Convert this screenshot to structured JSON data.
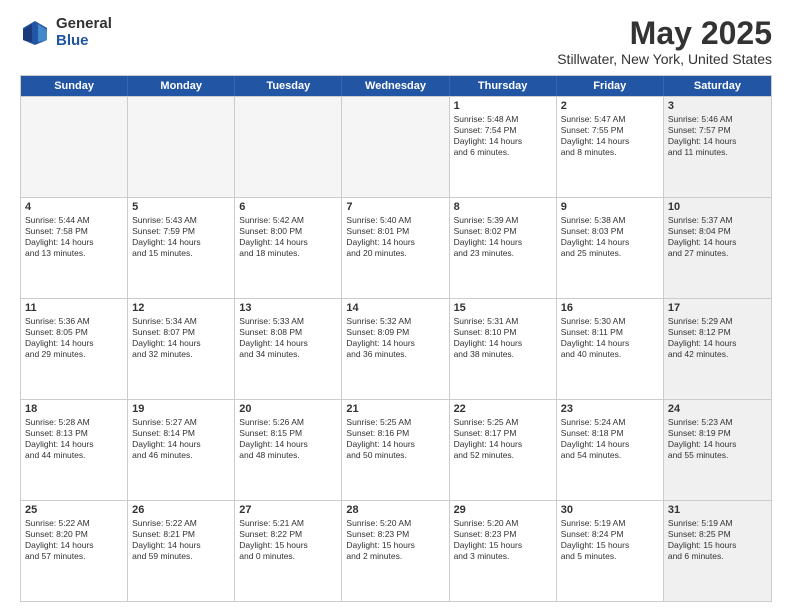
{
  "header": {
    "logo_general": "General",
    "logo_blue": "Blue",
    "title": "May 2025",
    "subtitle": "Stillwater, New York, United States"
  },
  "weekdays": [
    "Sunday",
    "Monday",
    "Tuesday",
    "Wednesday",
    "Thursday",
    "Friday",
    "Saturday"
  ],
  "rows": [
    [
      {
        "day": "",
        "info": "",
        "empty": true
      },
      {
        "day": "",
        "info": "",
        "empty": true
      },
      {
        "day": "",
        "info": "",
        "empty": true
      },
      {
        "day": "",
        "info": "",
        "empty": true
      },
      {
        "day": "1",
        "info": "Sunrise: 5:48 AM\nSunset: 7:54 PM\nDaylight: 14 hours\nand 6 minutes."
      },
      {
        "day": "2",
        "info": "Sunrise: 5:47 AM\nSunset: 7:55 PM\nDaylight: 14 hours\nand 8 minutes."
      },
      {
        "day": "3",
        "info": "Sunrise: 5:46 AM\nSunset: 7:57 PM\nDaylight: 14 hours\nand 11 minutes.",
        "shaded": true
      }
    ],
    [
      {
        "day": "4",
        "info": "Sunrise: 5:44 AM\nSunset: 7:58 PM\nDaylight: 14 hours\nand 13 minutes."
      },
      {
        "day": "5",
        "info": "Sunrise: 5:43 AM\nSunset: 7:59 PM\nDaylight: 14 hours\nand 15 minutes."
      },
      {
        "day": "6",
        "info": "Sunrise: 5:42 AM\nSunset: 8:00 PM\nDaylight: 14 hours\nand 18 minutes."
      },
      {
        "day": "7",
        "info": "Sunrise: 5:40 AM\nSunset: 8:01 PM\nDaylight: 14 hours\nand 20 minutes."
      },
      {
        "day": "8",
        "info": "Sunrise: 5:39 AM\nSunset: 8:02 PM\nDaylight: 14 hours\nand 23 minutes."
      },
      {
        "day": "9",
        "info": "Sunrise: 5:38 AM\nSunset: 8:03 PM\nDaylight: 14 hours\nand 25 minutes."
      },
      {
        "day": "10",
        "info": "Sunrise: 5:37 AM\nSunset: 8:04 PM\nDaylight: 14 hours\nand 27 minutes.",
        "shaded": true
      }
    ],
    [
      {
        "day": "11",
        "info": "Sunrise: 5:36 AM\nSunset: 8:05 PM\nDaylight: 14 hours\nand 29 minutes."
      },
      {
        "day": "12",
        "info": "Sunrise: 5:34 AM\nSunset: 8:07 PM\nDaylight: 14 hours\nand 32 minutes."
      },
      {
        "day": "13",
        "info": "Sunrise: 5:33 AM\nSunset: 8:08 PM\nDaylight: 14 hours\nand 34 minutes."
      },
      {
        "day": "14",
        "info": "Sunrise: 5:32 AM\nSunset: 8:09 PM\nDaylight: 14 hours\nand 36 minutes."
      },
      {
        "day": "15",
        "info": "Sunrise: 5:31 AM\nSunset: 8:10 PM\nDaylight: 14 hours\nand 38 minutes."
      },
      {
        "day": "16",
        "info": "Sunrise: 5:30 AM\nSunset: 8:11 PM\nDaylight: 14 hours\nand 40 minutes."
      },
      {
        "day": "17",
        "info": "Sunrise: 5:29 AM\nSunset: 8:12 PM\nDaylight: 14 hours\nand 42 minutes.",
        "shaded": true
      }
    ],
    [
      {
        "day": "18",
        "info": "Sunrise: 5:28 AM\nSunset: 8:13 PM\nDaylight: 14 hours\nand 44 minutes."
      },
      {
        "day": "19",
        "info": "Sunrise: 5:27 AM\nSunset: 8:14 PM\nDaylight: 14 hours\nand 46 minutes."
      },
      {
        "day": "20",
        "info": "Sunrise: 5:26 AM\nSunset: 8:15 PM\nDaylight: 14 hours\nand 48 minutes."
      },
      {
        "day": "21",
        "info": "Sunrise: 5:25 AM\nSunset: 8:16 PM\nDaylight: 14 hours\nand 50 minutes."
      },
      {
        "day": "22",
        "info": "Sunrise: 5:25 AM\nSunset: 8:17 PM\nDaylight: 14 hours\nand 52 minutes."
      },
      {
        "day": "23",
        "info": "Sunrise: 5:24 AM\nSunset: 8:18 PM\nDaylight: 14 hours\nand 54 minutes."
      },
      {
        "day": "24",
        "info": "Sunrise: 5:23 AM\nSunset: 8:19 PM\nDaylight: 14 hours\nand 55 minutes.",
        "shaded": true
      }
    ],
    [
      {
        "day": "25",
        "info": "Sunrise: 5:22 AM\nSunset: 8:20 PM\nDaylight: 14 hours\nand 57 minutes."
      },
      {
        "day": "26",
        "info": "Sunrise: 5:22 AM\nSunset: 8:21 PM\nDaylight: 14 hours\nand 59 minutes."
      },
      {
        "day": "27",
        "info": "Sunrise: 5:21 AM\nSunset: 8:22 PM\nDaylight: 15 hours\nand 0 minutes."
      },
      {
        "day": "28",
        "info": "Sunrise: 5:20 AM\nSunset: 8:23 PM\nDaylight: 15 hours\nand 2 minutes."
      },
      {
        "day": "29",
        "info": "Sunrise: 5:20 AM\nSunset: 8:23 PM\nDaylight: 15 hours\nand 3 minutes."
      },
      {
        "day": "30",
        "info": "Sunrise: 5:19 AM\nSunset: 8:24 PM\nDaylight: 15 hours\nand 5 minutes."
      },
      {
        "day": "31",
        "info": "Sunrise: 5:19 AM\nSunset: 8:25 PM\nDaylight: 15 hours\nand 6 minutes.",
        "shaded": true
      }
    ]
  ]
}
